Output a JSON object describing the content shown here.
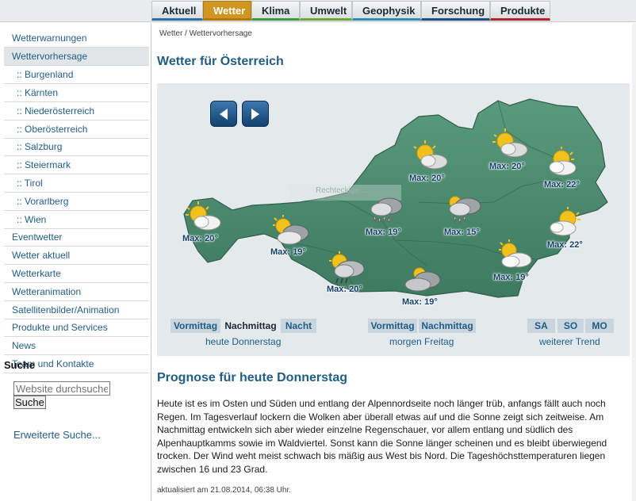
{
  "topnav": {
    "tabs": [
      {
        "label": "Aktuell",
        "accent": "#2a6fb0"
      },
      {
        "label": "Wetter",
        "accent": "#d1961f",
        "active": true
      },
      {
        "label": "Klima",
        "accent": "#3a9c42"
      },
      {
        "label": "Umwelt",
        "accent": "#6aa83a"
      },
      {
        "label": "Geophysik",
        "accent": "#2a8fb0"
      },
      {
        "label": "Forschung",
        "accent": "#1f4e85"
      },
      {
        "label": "Produkte",
        "accent": "#b0262e"
      }
    ]
  },
  "sidebar": {
    "items": [
      {
        "label": "Wetterwarnungen"
      },
      {
        "label": "Wettervorhersage",
        "active": true
      },
      {
        "label": ":: Burgenland"
      },
      {
        "label": ":: Kärnten"
      },
      {
        "label": ":: Niederösterreich"
      },
      {
        "label": ":: Oberösterreich"
      },
      {
        "label": ":: Salzburg"
      },
      {
        "label": ":: Steiermark"
      },
      {
        "label": ":: Tirol"
      },
      {
        "label": ":: Vorarlberg"
      },
      {
        "label": ":: Wien"
      },
      {
        "label": "Eventwetter"
      },
      {
        "label": "Wetter aktuell"
      },
      {
        "label": "Wetterkarte"
      },
      {
        "label": "Wetteranimation"
      },
      {
        "label": "Satellitenbilder/Animation"
      },
      {
        "label": "Produkte und Services"
      },
      {
        "label": "News"
      },
      {
        "label": "Team und Kontakte"
      }
    ],
    "search_heading": "Suche",
    "search_placeholder": "Website durchsuchen",
    "search_button": "Suche",
    "advanced_search": "Erweiterte Suche..."
  },
  "main": {
    "breadcrumb": "Wetter / Wettervorhersage",
    "title": "Wetter für Österreich",
    "map_watermark": "Rechteckige ...",
    "forecasts": [
      {
        "region": "vorarlberg",
        "icon": "sun-cloud-icon",
        "max": "Max: 20°"
      },
      {
        "region": "tirol",
        "icon": "cloud-sun-icon",
        "max": "Max: 19°"
      },
      {
        "region": "osttirol",
        "icon": "sun-rain-icon",
        "max": "Max: 20°"
      },
      {
        "region": "salzburg",
        "icon": "cloud-rain-icon",
        "max": "Max: 19°"
      },
      {
        "region": "kaernten",
        "icon": "cloudy-icon",
        "max": "Max: 19°"
      },
      {
        "region": "oberoesterreich",
        "icon": "sun-cloud-icon",
        "max": "Max: 20°"
      },
      {
        "region": "steiermark",
        "icon": "cloud-rain-icon",
        "max": "Max: 15°"
      },
      {
        "region": "waldviertel",
        "icon": "sun-cloud-icon",
        "max": "Max: 20°"
      },
      {
        "region": "niederoesterreich",
        "icon": "sun-cloud-icon",
        "max": "Max: 22°"
      },
      {
        "region": "wien",
        "icon": "sun-cloud-icon",
        "max": "Max: 22°"
      },
      {
        "region": "burgenland",
        "icon": "cloud-sun-icon",
        "max": "Max: 19°"
      }
    ],
    "time_buttons": {
      "today": [
        "Vormittag",
        "Nachmittag",
        "Nacht"
      ],
      "tomorrow": [
        "Vormittag",
        "Nachmittag"
      ],
      "trend": [
        "SA",
        "SO",
        "MO"
      ],
      "active": "Nachmittag"
    },
    "time_labels": {
      "today": "heute Donnerstag",
      "tomorrow": "morgen Freitag",
      "trend": "weiterer Trend"
    },
    "section_title": "Prognose für heute Donnerstag",
    "body": "Heute ist es im Osten und Süden und entlang der Alpennordseite noch länger trüb, anfangs fällt auch noch Regen. Im Tagesverlauf lockern die Wolken aber überall etwas auf und die Sonne zeigt sich zeitweise. Am Nachmittag entwickeln sich aber wieder einzelne Regenschauer, vor allem entlang und südlich des Alpenhauptkamms sowie im Waldviertel. Sonst kann die Sonne länger scheinen und es bleibt überwiegend trocken. Der Wind weht meist schwach bis mäßig aus West bis Nord. Die Tageshöchsttemperaturen liegen zwischen 16 und 23 Grad.",
    "updated": "aktualisiert am 21.08.2014, 06:38 Uhr."
  },
  "colors": {
    "link": "#1f5d8a",
    "map_land": "#4a8a6f",
    "active_tab": "#d1961f"
  }
}
